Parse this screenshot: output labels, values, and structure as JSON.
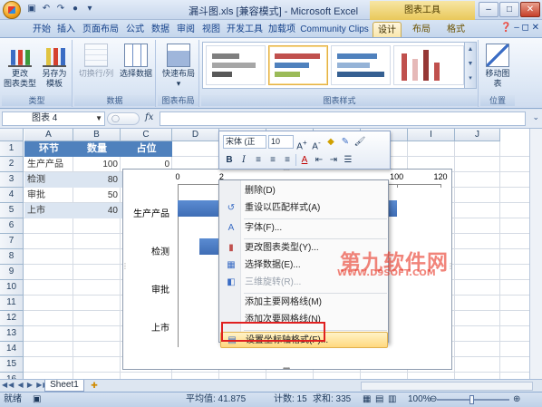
{
  "app": {
    "title": "漏斗图.xls [兼容模式] - Microsoft Excel",
    "context_title": "图表工具",
    "quick_access": [
      "save-icon",
      "undo-icon",
      "redo-icon",
      "record-icon"
    ]
  },
  "tabs": [
    {
      "label": "开始"
    },
    {
      "label": "插入"
    },
    {
      "label": "页面布局"
    },
    {
      "label": "公式"
    },
    {
      "label": "数据"
    },
    {
      "label": "审阅"
    },
    {
      "label": "视图"
    },
    {
      "label": "开发工具"
    },
    {
      "label": "加载项"
    },
    {
      "label": "Community Clips"
    },
    {
      "label": "设计"
    },
    {
      "label": "布局"
    },
    {
      "label": "格式"
    }
  ],
  "ribbon": {
    "groups": {
      "type": "类型",
      "data": "数据",
      "layout": "图表布局",
      "styles": "图表样式",
      "location": "位置"
    },
    "buttons": {
      "change_type": "更改\n图表类型",
      "save_template": "另存为\n模板",
      "switch_row_col": "切换行/列",
      "select_data": "选择数据",
      "quick_layout": "快速布局",
      "move_chart": "移动图表"
    },
    "style_colors": [
      "#7f7f7f",
      "#4f81bd",
      "#4f81bd",
      "#c0504d"
    ]
  },
  "formula_bar": {
    "name_box": "图表 4",
    "fx": "fx",
    "value": ""
  },
  "columns": [
    "A",
    "B",
    "C",
    "D",
    "E",
    "F",
    "G",
    "H",
    "I",
    "J"
  ],
  "rows": [
    "1",
    "2",
    "3",
    "4",
    "5",
    "6",
    "7",
    "8",
    "9",
    "10",
    "11",
    "12",
    "13",
    "14",
    "15",
    "16"
  ],
  "table": {
    "headers": [
      "环节",
      "数量",
      "占位"
    ],
    "rows": [
      {
        "stage": "生产产品",
        "qty": "100",
        "pad": "0"
      },
      {
        "stage": "检测",
        "qty": "80",
        "pad": ""
      },
      {
        "stage": "审批",
        "qty": "50",
        "pad": ""
      },
      {
        "stage": "上市",
        "qty": "40",
        "pad": ""
      }
    ]
  },
  "chart_data": {
    "type": "bar",
    "orientation": "horizontal",
    "categories": [
      "生产产品",
      "检测",
      "审批",
      "上市"
    ],
    "series": [
      {
        "name": "占位",
        "values": [
          0,
          10,
          25,
          30
        ]
      },
      {
        "name": "数量",
        "values": [
          100,
          80,
          50,
          40
        ]
      }
    ],
    "axis_ticks": [
      "0",
      "2",
      "100",
      "120"
    ],
    "xlim": [
      0,
      120
    ]
  },
  "mini_toolbar": {
    "font": "宋体 (正",
    "size": "10",
    "row2": [
      "B",
      "I",
      "≡",
      "≡",
      "≡",
      "A",
      "⇤",
      "⇥",
      "☰"
    ]
  },
  "context_menu": [
    {
      "label": "删除(D)",
      "icon": "delete-icon",
      "enabled": true
    },
    {
      "label": "重设以匹配样式(A)",
      "icon": "reset-icon",
      "enabled": true
    },
    {
      "sep": true
    },
    {
      "label": "字体(F)...",
      "icon": "font-icon",
      "enabled": true
    },
    {
      "sep": true
    },
    {
      "label": "更改图表类型(Y)...",
      "icon": "chart-icon",
      "enabled": true
    },
    {
      "label": "选择数据(E)...",
      "icon": "select-data-icon",
      "enabled": true
    },
    {
      "label": "三维旋转(R)...",
      "icon": "rotate-3d-icon",
      "enabled": false
    },
    {
      "sep": true
    },
    {
      "label": "添加主要网格线(M)",
      "icon": "",
      "enabled": true
    },
    {
      "label": "添加次要网格线(N)",
      "icon": "",
      "enabled": true
    },
    {
      "sep": true
    },
    {
      "label": "设置坐标轴格式(F)...",
      "icon": "format-axis-icon",
      "enabled": true,
      "highlight": true
    }
  ],
  "watermark": {
    "line1": "第九软件网",
    "line2": "WWW.D9SOFT.COM"
  },
  "sheet_tab": "Sheet1",
  "status": {
    "ready": "就绪",
    "average": "平均值: 41.875",
    "count": "计数: 15",
    "sum": "求和: 335",
    "zoom": "100%"
  }
}
